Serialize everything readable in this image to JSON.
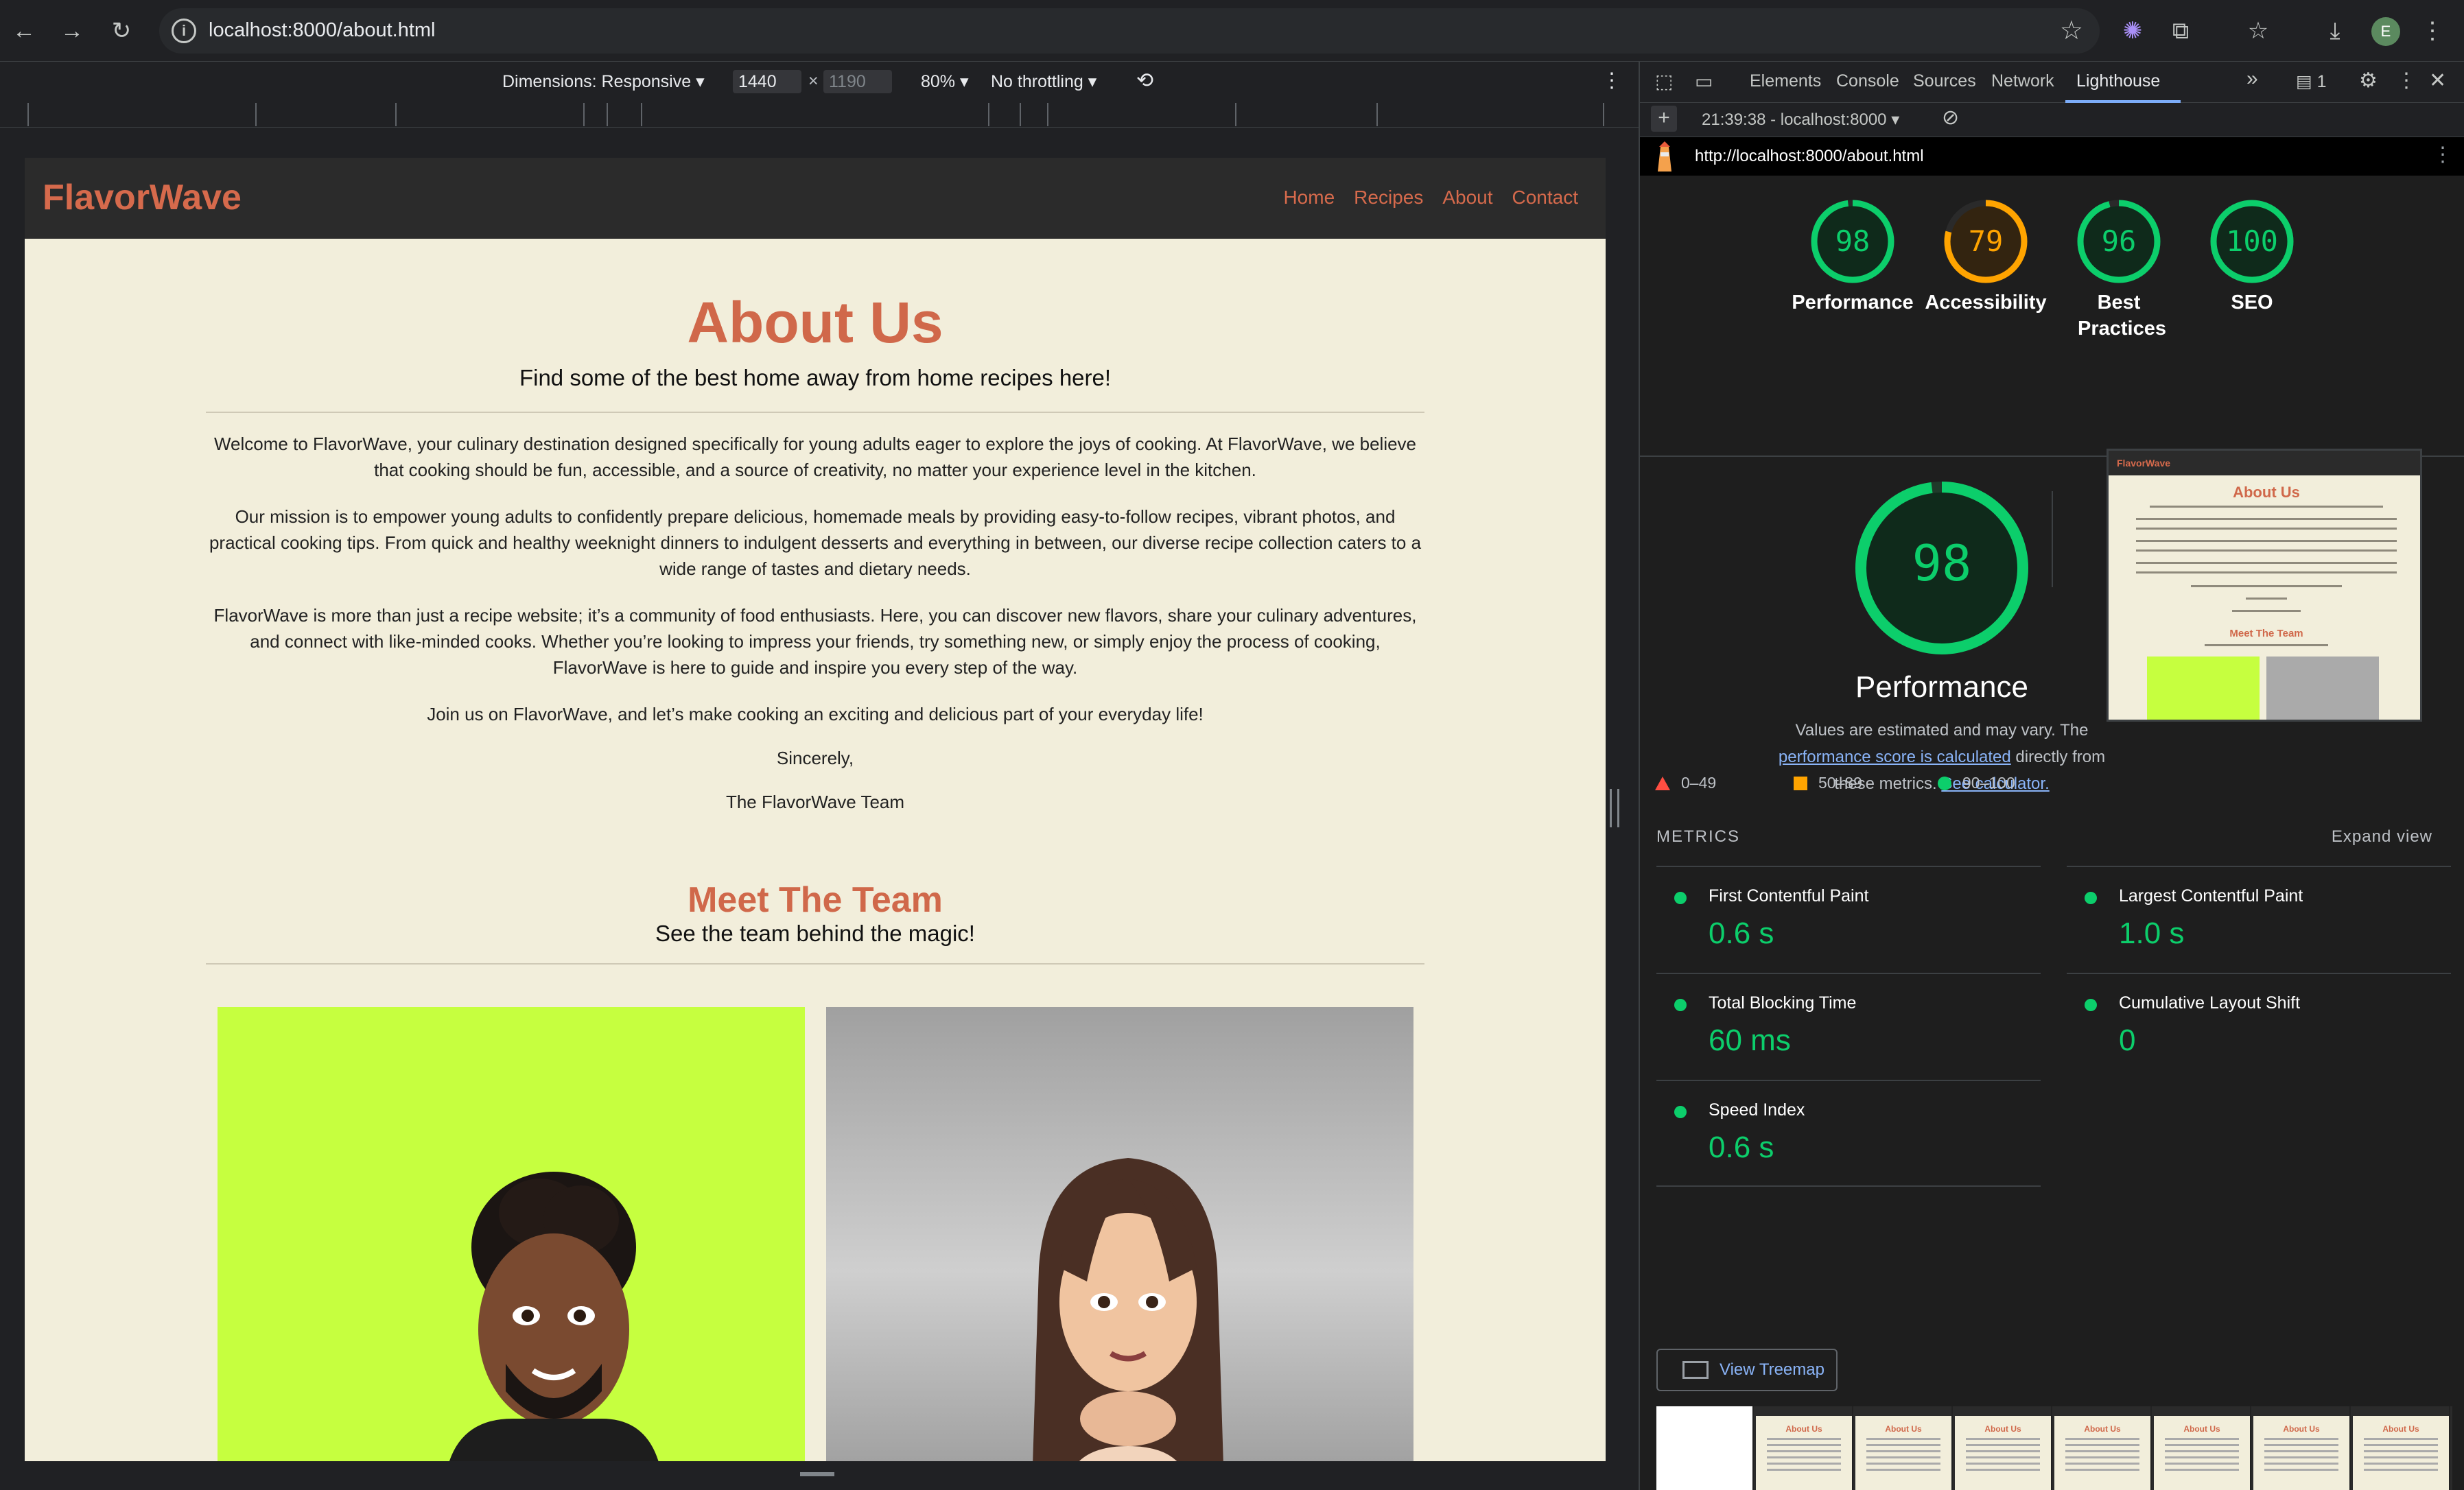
{
  "browser": {
    "url": "localhost:8000/about.html"
  },
  "device_toolbar": {
    "dimensions_label": "Dimensions: Responsive",
    "width": "1440",
    "height": "1190",
    "times": "×",
    "zoom": "80%",
    "throttling": "No throttling"
  },
  "site": {
    "logo": "FlavorWave",
    "nav": [
      "Home",
      "Recipes",
      "About",
      "Contact"
    ],
    "title": "About Us",
    "subtitle": "Find some of the best home away from home recipes here!",
    "paragraphs": [
      "Welcome to FlavorWave, your culinary destination designed specifically for young adults eager to explore the joys of cooking. At FlavorWave, we believe that cooking should be fun, accessible, and a source of creativity, no matter your experience level in the kitchen.",
      "Our mission is to empower young adults to confidently prepare delicious, homemade meals by providing easy-to-follow recipes, vibrant photos, and practical cooking tips. From quick and healthy weeknight dinners to indulgent desserts and everything in between, our diverse recipe collection caters to a wide range of tastes and dietary needs.",
      "FlavorWave is more than just a recipe website; it’s a community of food enthusiasts. Here, you can discover new flavors, share your culinary adventures, and connect with like-minded cooks. Whether you’re looking to impress your friends, try something new, or simply enjoy the process of cooking, FlavorWave is here to guide and inspire you every step of the way.",
      "Join us on FlavorWave, and let’s make cooking an exciting and delicious part of your everyday life!",
      "Sincerely,",
      "The FlavorWave Team"
    ],
    "team_title": "Meet The Team",
    "team_subtitle": "See the team behind the magic!"
  },
  "devtools": {
    "tabs": [
      "Elements",
      "Console",
      "Sources",
      "Network",
      "Lighthouse"
    ],
    "active_tab": "Lighthouse",
    "issues_count": "1",
    "report_selector": "21:39:38 - localhost:8000",
    "report_url": "http://localhost:8000/about.html",
    "scores": [
      {
        "label": "Performance",
        "value": 98,
        "color": "#0cce6b"
      },
      {
        "label": "Accessibility",
        "value": 79,
        "color": "#ffa400"
      },
      {
        "label": "Best Practices",
        "value": 96,
        "color": "#0cce6b"
      },
      {
        "label": "SEO",
        "value": 100,
        "color": "#0cce6b"
      }
    ],
    "main_score": {
      "value": "98",
      "label": "Performance"
    },
    "note_prefix": "Values are estimated and may vary. The",
    "note_link1": "performance score is calculated",
    "note_middle": "directly from these metrics.",
    "note_link2": "See calculator.",
    "legend": [
      {
        "range": "0–49",
        "color": "#ff4e42"
      },
      {
        "range": "50–89",
        "color": "#ffa400"
      },
      {
        "range": "90–100",
        "color": "#0cce6b"
      }
    ],
    "metrics_heading": "METRICS",
    "expand_label": "Expand view",
    "metrics": [
      {
        "name": "First Contentful Paint",
        "value": "0.6 s"
      },
      {
        "name": "Largest Contentful Paint",
        "value": "1.0 s"
      },
      {
        "name": "Total Blocking Time",
        "value": "60 ms"
      },
      {
        "name": "Cumulative Layout Shift",
        "value": "0"
      },
      {
        "name": "Speed Index",
        "value": "0.6 s"
      }
    ],
    "treemap_label": "View Treemap",
    "thumb_logo": "FlavorWave",
    "thumb_title": "About Us",
    "thumb_team": "Meet The Team"
  },
  "colors": {
    "brand_accent": "#d0684a",
    "page_bg": "#f2eedb",
    "header_bg": "#2b2b2b",
    "pass_green": "#0cce6b",
    "average_orange": "#ffa400"
  }
}
